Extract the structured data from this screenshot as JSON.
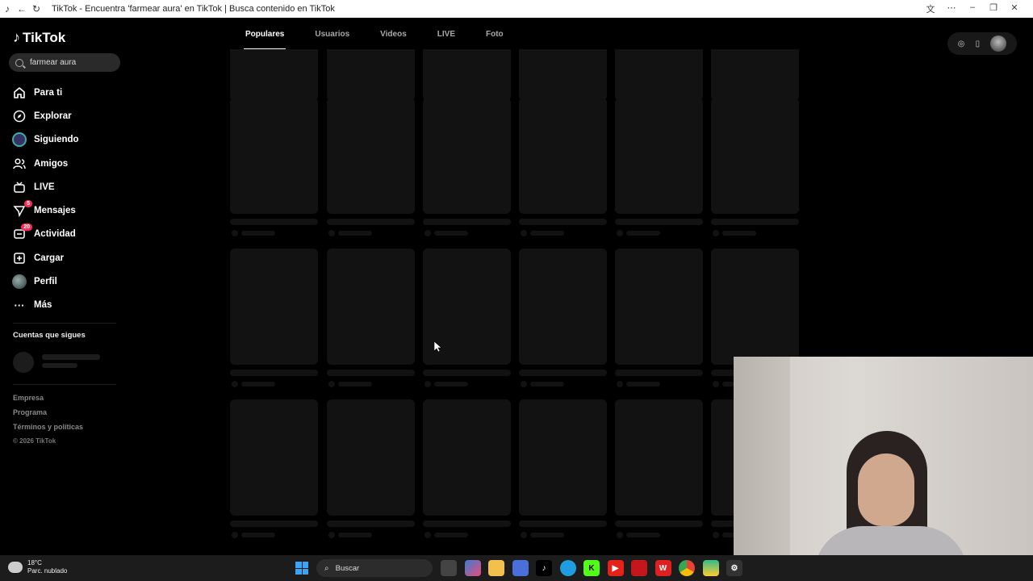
{
  "browser": {
    "title": "TikTok - Encuentra 'farmear aura' en TikTok | Busca contenido en TikTok"
  },
  "logo": {
    "text": "TikTok"
  },
  "search": {
    "value": "farmear aura"
  },
  "nav": {
    "items": [
      {
        "label": "Para ti",
        "icon": "home-icon"
      },
      {
        "label": "Explorar",
        "icon": "compass-icon"
      },
      {
        "label": "Siguiendo",
        "icon": "following-avatar-icon"
      },
      {
        "label": "Amigos",
        "icon": "friends-icon"
      },
      {
        "label": "LIVE",
        "icon": "live-icon"
      },
      {
        "label": "Mensajes",
        "icon": "messages-icon",
        "badge": "5"
      },
      {
        "label": "Actividad",
        "icon": "activity-icon",
        "badge": "20"
      },
      {
        "label": "Cargar",
        "icon": "upload-icon"
      },
      {
        "label": "Perfil",
        "icon": "profile-avatar-icon"
      },
      {
        "label": "Más",
        "icon": "more-icon"
      }
    ]
  },
  "following": {
    "title": "Cuentas que sigues"
  },
  "footer": {
    "links": [
      "Empresa",
      "Programa",
      "Términos y políticas"
    ],
    "copyright": "© 2026 TikTok"
  },
  "tabs": [
    {
      "label": "Populares",
      "active": true
    },
    {
      "label": "Usuarios"
    },
    {
      "label": "Videos"
    },
    {
      "label": "LIVE"
    },
    {
      "label": "Foto"
    }
  ],
  "taskbar": {
    "weather_temp": "18°C",
    "weather_desc": "Parc. nublado",
    "search_placeholder": "Buscar"
  },
  "colors": {
    "background": "#000000",
    "skeleton": "#121212",
    "accent": "#fe2c55"
  }
}
